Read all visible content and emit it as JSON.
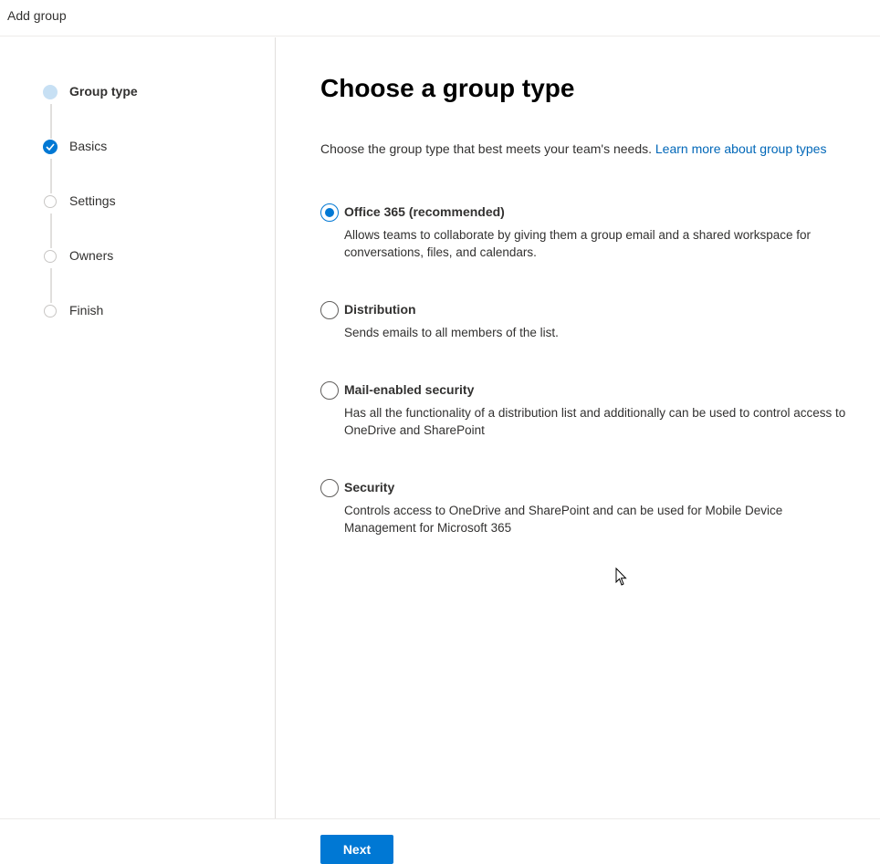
{
  "header": {
    "title": "Add group"
  },
  "steps": [
    {
      "label": "Group type",
      "state": "current"
    },
    {
      "label": "Basics",
      "state": "done"
    },
    {
      "label": "Settings",
      "state": "todo"
    },
    {
      "label": "Owners",
      "state": "todo"
    },
    {
      "label": "Finish",
      "state": "todo"
    }
  ],
  "main": {
    "heading": "Choose a group type",
    "intro_text": "Choose the group type that best meets your team's needs.",
    "learn_more_link": "Learn more about group types",
    "options": [
      {
        "title": "Office 365 (recommended)",
        "description": "Allows teams to collaborate by giving them a group email and a shared workspace for conversations, files, and calendars.",
        "selected": true
      },
      {
        "title": "Distribution",
        "description": "Sends emails to all members of the list.",
        "selected": false
      },
      {
        "title": "Mail-enabled security",
        "description": "Has all the functionality of a distribution list and additionally can be used to control access to OneDrive and SharePoint",
        "selected": false
      },
      {
        "title": "Security",
        "description": "Controls access to OneDrive and SharePoint and can be used for Mobile Device Management for Microsoft 365",
        "selected": false
      }
    ]
  },
  "footer": {
    "next_label": "Next"
  },
  "colors": {
    "accent": "#0078d4",
    "link": "#0067b8",
    "current_step": "#c7e0f4"
  },
  "icons": {
    "done_step": "checkmark-icon",
    "cursor": "mouse-pointer-icon"
  }
}
